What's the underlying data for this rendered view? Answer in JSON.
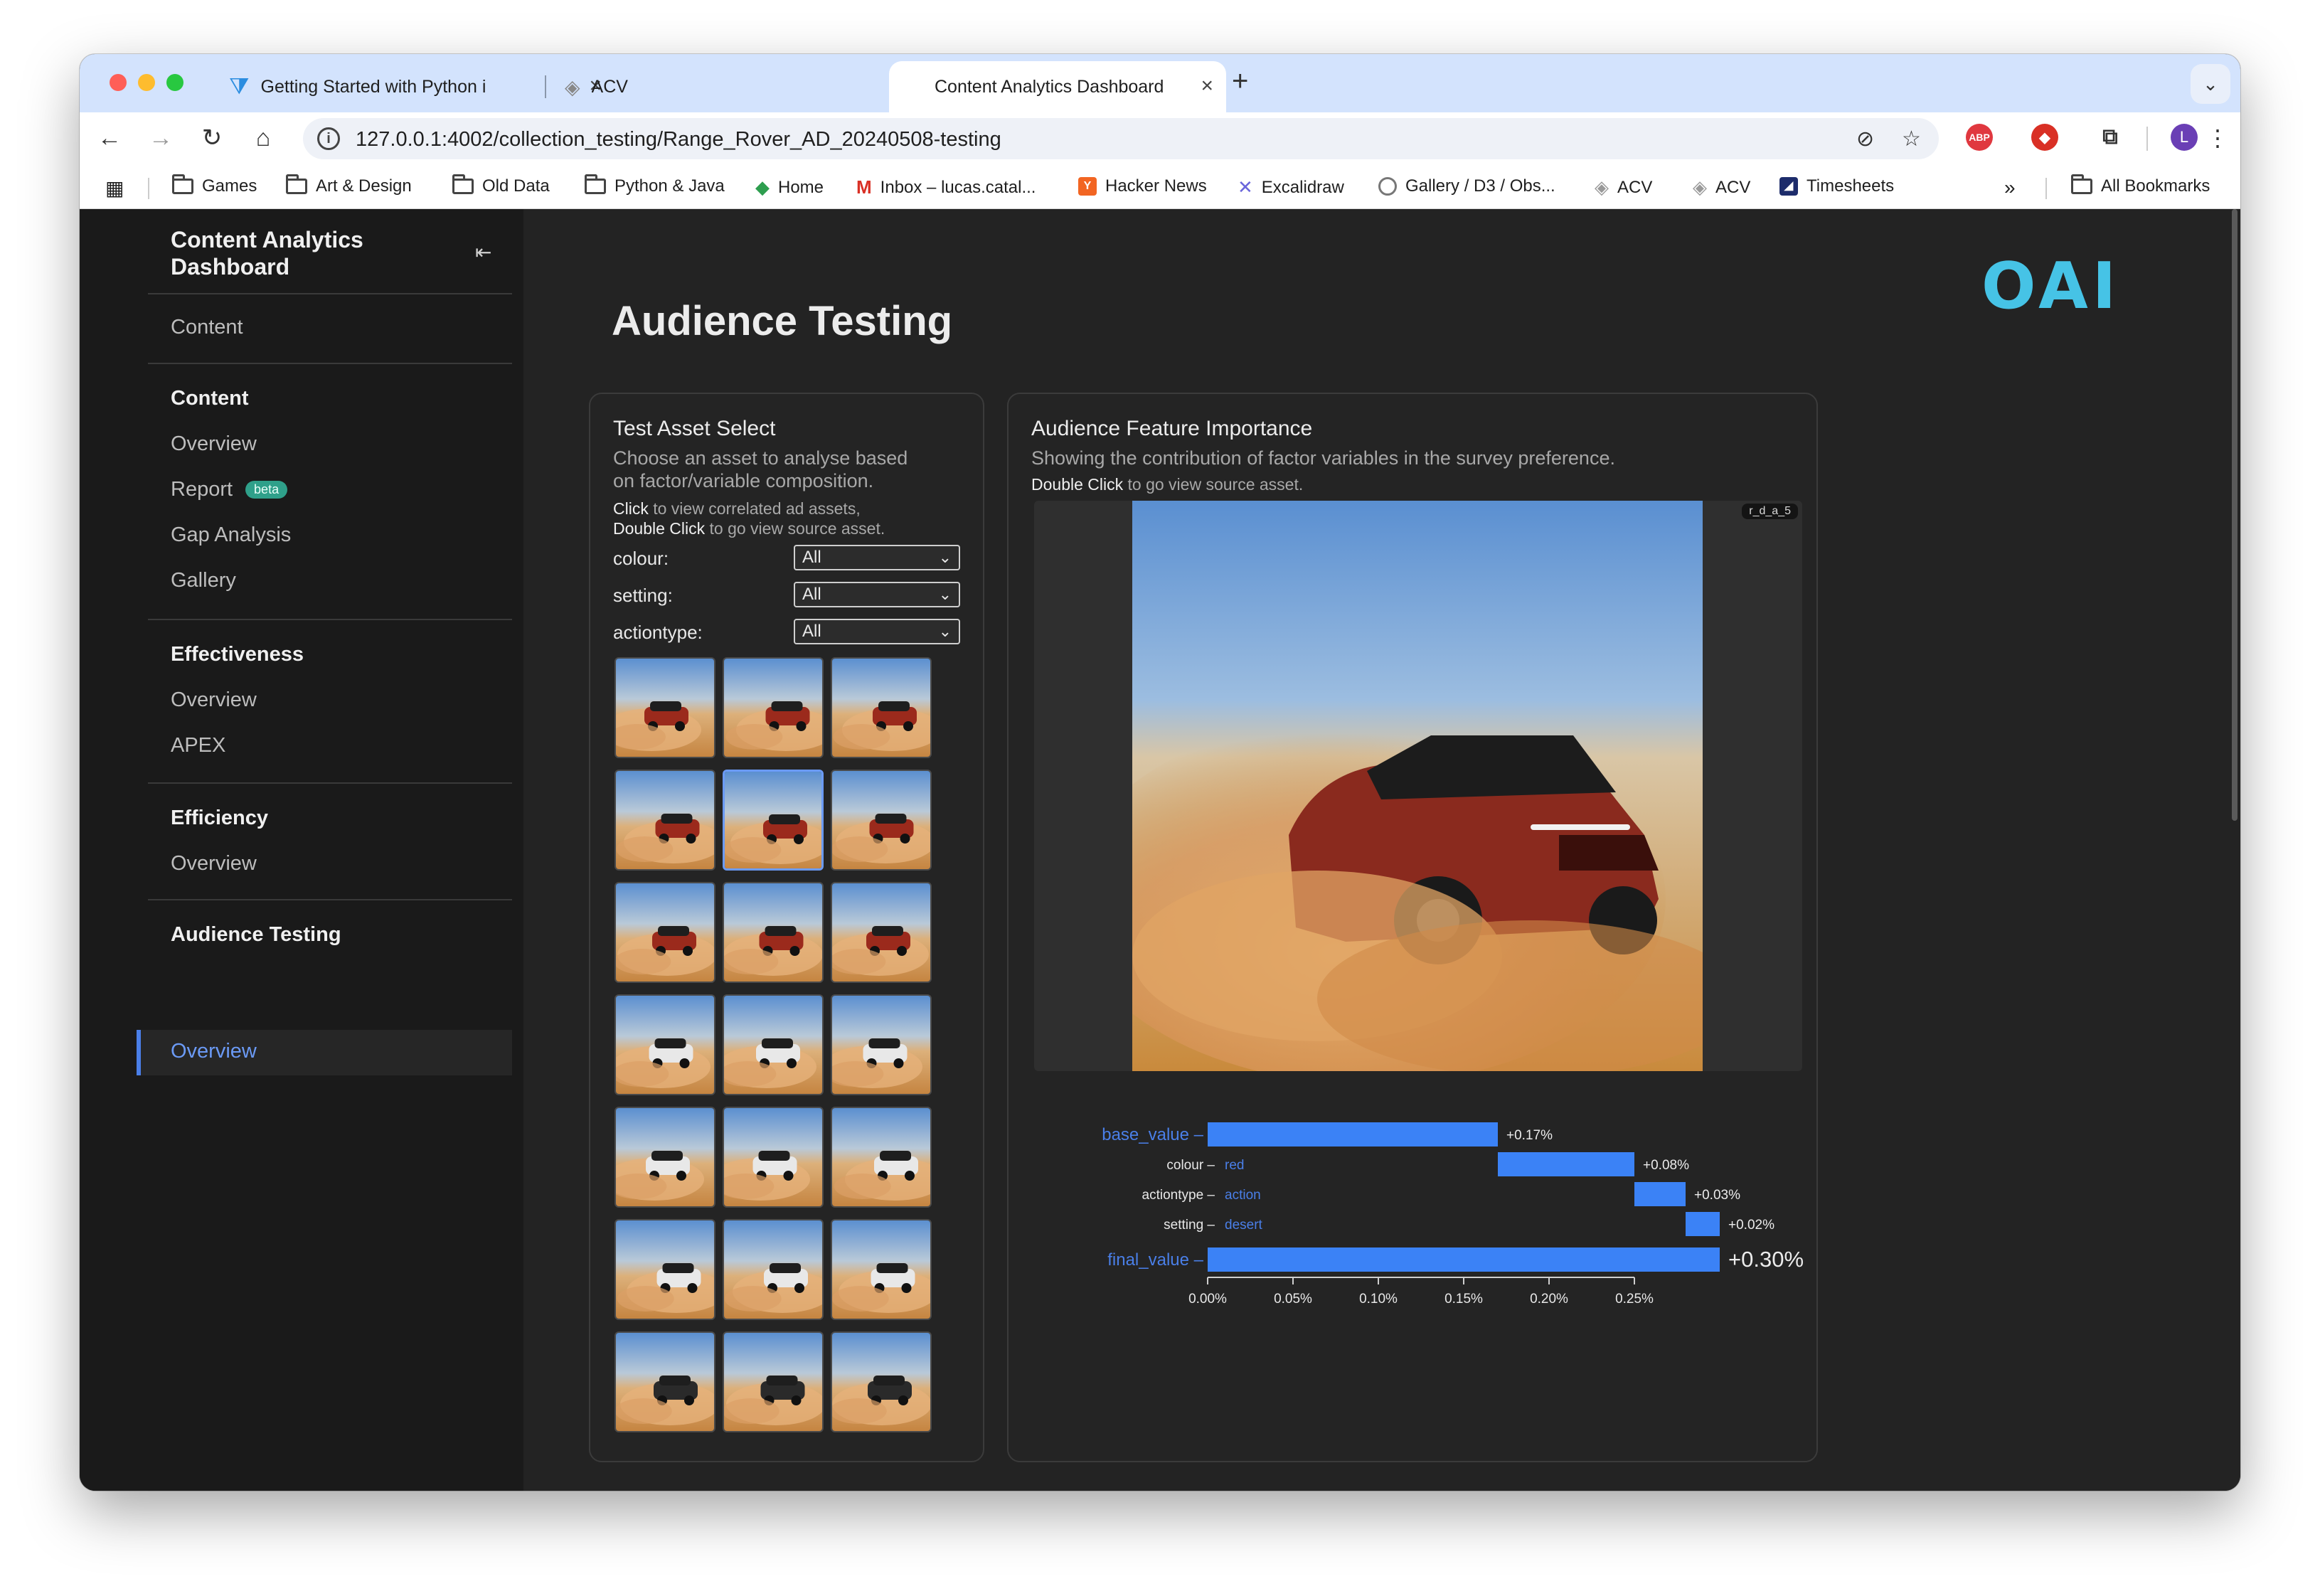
{
  "browser": {
    "tabs": [
      {
        "label": "Getting Started with Python i",
        "close": "×"
      },
      {
        "label": "ACV",
        "close": "×"
      },
      {
        "label": "Content Analytics Dashboard",
        "close": "×"
      }
    ],
    "new_tab": "+",
    "tab_menu": "⌄",
    "url": "127.0.0.1:4002/collection_testing/Range_Rover_AD_20240508-testing",
    "profile_initial": "L",
    "ext_abp": "ABP",
    "bookmarks": [
      {
        "label": "Games",
        "icon": "folder-icon"
      },
      {
        "label": "Art & Design",
        "icon": "folder-icon"
      },
      {
        "label": "Old Data",
        "icon": "folder-icon"
      },
      {
        "label": "Python & Java",
        "icon": "folder-icon"
      },
      {
        "label": "Home",
        "icon": "diamond-icon"
      },
      {
        "label": "Inbox – lucas.catal...",
        "icon": "gmail-icon"
      },
      {
        "label": "Hacker News",
        "icon": "y-icon"
      },
      {
        "label": "Excalidraw",
        "icon": "excalidraw-icon"
      },
      {
        "label": "Gallery / D3 / Obs...",
        "icon": "observable-icon"
      },
      {
        "label": "ACV",
        "icon": "acv-icon"
      },
      {
        "label": "ACV",
        "icon": "acv-icon"
      },
      {
        "label": "Timesheets",
        "icon": "timesheets-icon"
      }
    ],
    "bookmarks_overflow": "»",
    "all_bookmarks": "All Bookmarks"
  },
  "sidebar": {
    "title": "Content Analytics Dashboard",
    "collapse_icon": "⇤",
    "top_item": "Content",
    "sections": [
      {
        "heading": "Content",
        "items": [
          "Overview",
          "Report",
          "Gap Analysis",
          "Gallery"
        ],
        "badge": "beta"
      },
      {
        "heading": "Effectiveness",
        "items": [
          "Overview",
          "APEX"
        ]
      },
      {
        "heading": "Efficiency",
        "items": [
          "Overview"
        ]
      },
      {
        "heading": "Audience Testing",
        "items": [
          "Overview"
        ]
      }
    ]
  },
  "logo": "OAI",
  "page_title": "Audience Testing",
  "asset_select": {
    "title": "Test Asset Select",
    "subtitle_line1": "Choose an asset to analyse based",
    "subtitle_line2": "on factor/variable composition.",
    "hint1_bold": "Click",
    "hint1_rest": " to view correlated ad assets,",
    "hint2_bold": "Double Click",
    "hint2_rest": " to go view source asset.",
    "filters": [
      {
        "label": "colour:",
        "value": "All"
      },
      {
        "label": "setting:",
        "value": "All"
      },
      {
        "label": "actiontype:",
        "value": "All"
      }
    ],
    "thumbnails": [
      {
        "color": "red"
      },
      {
        "color": "red"
      },
      {
        "color": "red"
      },
      {
        "color": "red"
      },
      {
        "color": "red"
      },
      {
        "color": "red"
      },
      {
        "color": "red"
      },
      {
        "color": "red"
      },
      {
        "color": "red"
      },
      {
        "color": "white"
      },
      {
        "color": "white"
      },
      {
        "color": "white"
      },
      {
        "color": "white"
      },
      {
        "color": "white"
      },
      {
        "color": "white"
      },
      {
        "color": "white"
      },
      {
        "color": "white"
      },
      {
        "color": "white"
      },
      {
        "color": "black"
      },
      {
        "color": "black"
      },
      {
        "color": "black"
      }
    ],
    "selected_index": 4
  },
  "feature_importance": {
    "title": "Audience Feature Importance",
    "subtitle": "Showing the contribution of factor variables in the survey preference.",
    "hint_bold": "Double Click",
    "hint_rest": " to go view source asset.",
    "image_tag": "r_d_a_5"
  },
  "chart_data": {
    "type": "bar",
    "subtype": "waterfall",
    "rows": [
      {
        "label": "base_value",
        "value_label": "",
        "start": 0.0,
        "delta": 0.17,
        "display": "+0.17%",
        "highlight": true
      },
      {
        "label": "colour",
        "value_label": "red",
        "start": 0.17,
        "delta": 0.08,
        "display": "+0.08%",
        "highlight": false
      },
      {
        "label": "actiontype",
        "value_label": "action",
        "start": 0.25,
        "delta": 0.03,
        "display": "+0.03%",
        "highlight": false
      },
      {
        "label": "setting",
        "value_label": "desert",
        "start": 0.28,
        "delta": 0.02,
        "display": "+0.02%",
        "highlight": false
      },
      {
        "label": "final_value",
        "value_label": "",
        "start": 0.0,
        "delta": 0.3,
        "display": "+0.30%",
        "highlight": true
      }
    ],
    "x_ticks": [
      "0.00%",
      "0.05%",
      "0.10%",
      "0.15%",
      "0.20%",
      "0.25%"
    ],
    "tick_values": [
      0,
      0.05,
      0.1,
      0.15,
      0.2,
      0.25
    ],
    "xlim": [
      0,
      0.3
    ],
    "bar_color": "#3b82f6",
    "accent_label_color": "#4a7fe8"
  }
}
